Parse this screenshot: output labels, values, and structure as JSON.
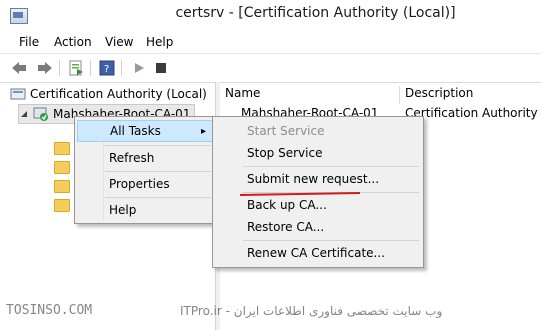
{
  "window": {
    "title": "certsrv - [Certification Authority (Local)]"
  },
  "menubar": {
    "items": [
      "File",
      "Action",
      "View",
      "Help"
    ]
  },
  "tree": {
    "root_label": "Certification Authority (Local)",
    "ca_label": "Mahshaher-Root-CA-01"
  },
  "list": {
    "columns": [
      "Name",
      "Description"
    ],
    "rows": [
      {
        "name": "Mahshaher-Root-CA-01",
        "description": "Certification Authority"
      }
    ]
  },
  "context_menu": {
    "items": [
      "All Tasks",
      "Refresh",
      "Properties",
      "Help"
    ],
    "submenu_arrow": "▸"
  },
  "submenu": {
    "items": [
      "Start Service",
      "Stop Service",
      "Submit new request...",
      "Back up CA...",
      "Restore CA...",
      "Renew CA Certificate..."
    ]
  },
  "watermarks": {
    "left": "TOSINSO.COM",
    "right": "ITPro.ir - وب سایت تخصصی فناوری اطلاعات ایران"
  },
  "colors": {
    "highlight": "#cde8ff",
    "annotation": "#d01c1c",
    "folder": "#f4cd5c"
  }
}
